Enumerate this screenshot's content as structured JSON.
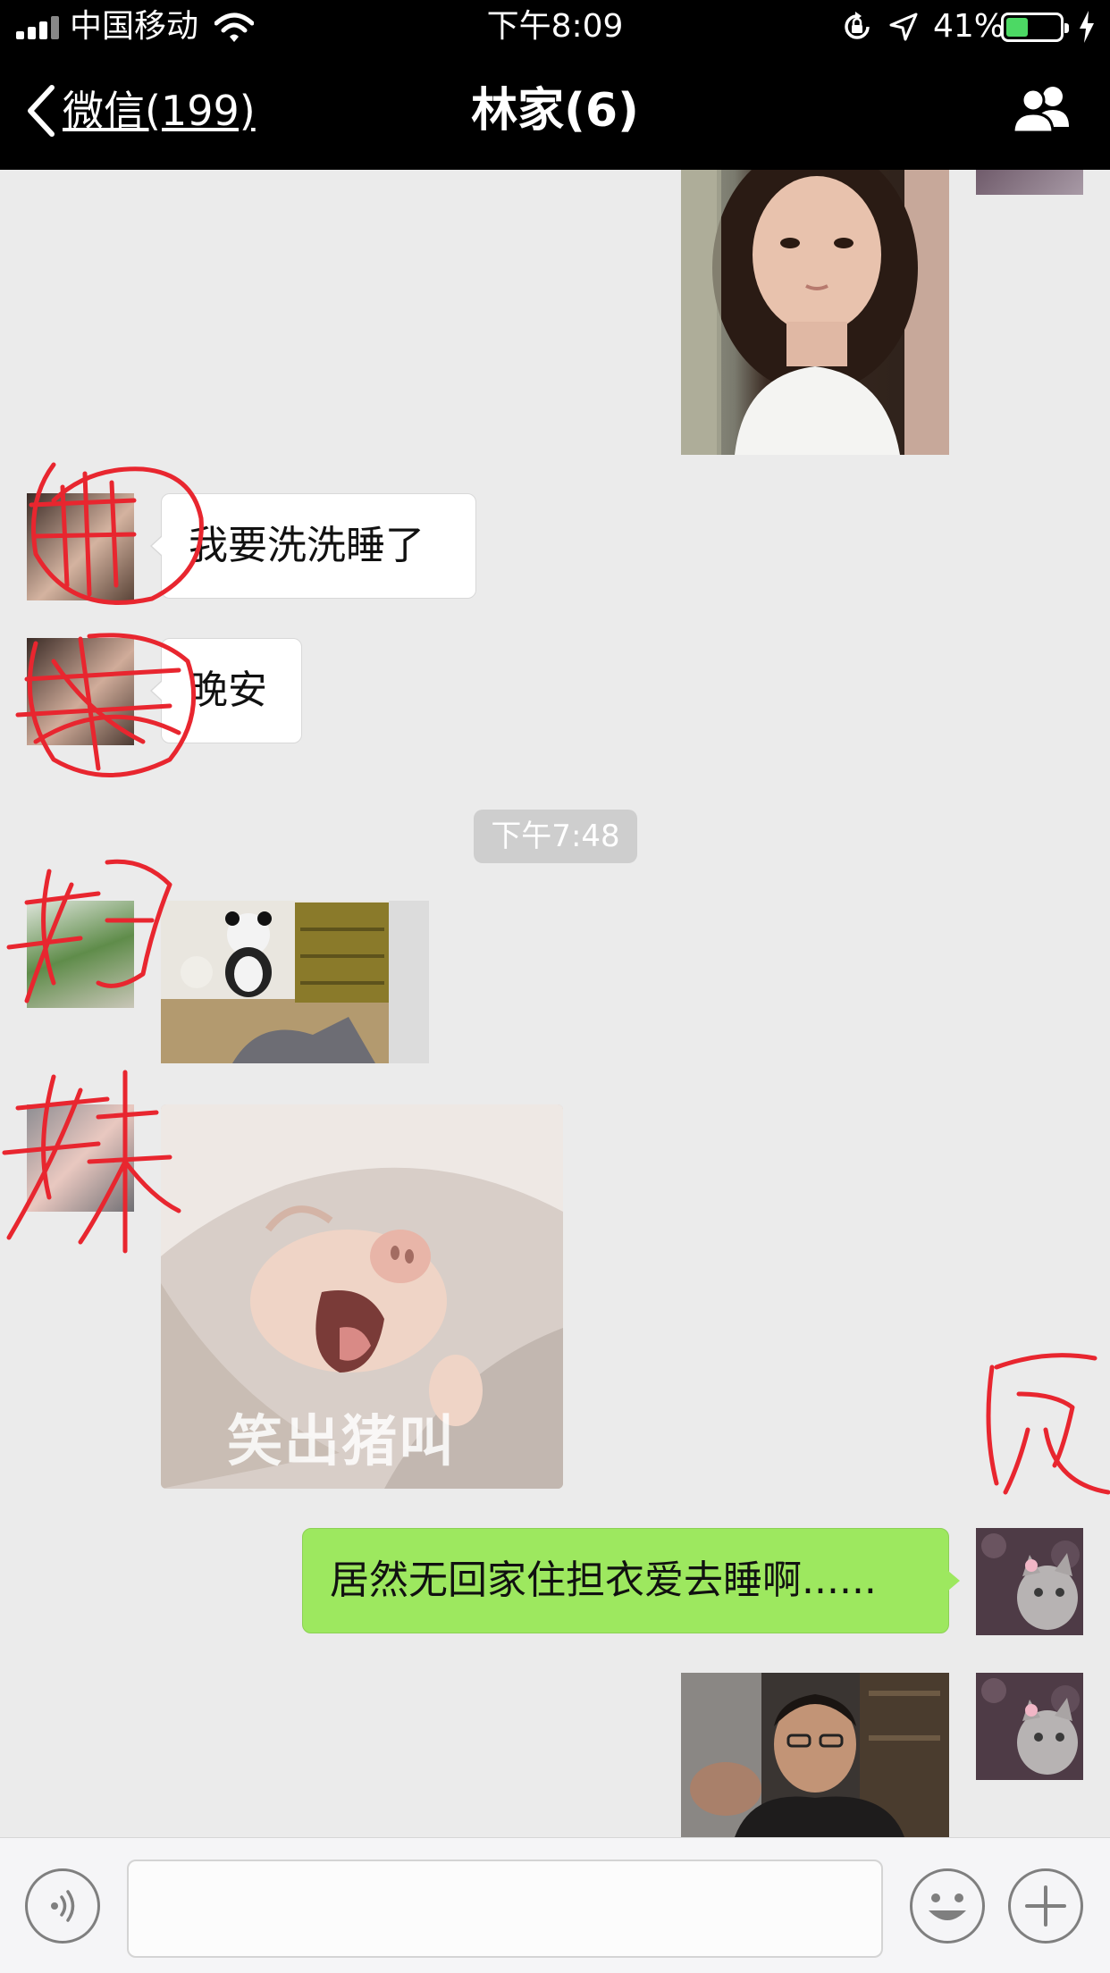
{
  "status_bar": {
    "carrier": "中国移动",
    "time": "下午8:09",
    "battery_percent": "41%",
    "battery_level": 0.41
  },
  "nav": {
    "back_label": "微信(199)",
    "title": "林家(6)"
  },
  "messages": {
    "text_1": "我要洗洗睡了",
    "text_2": "晚安",
    "timestamp": "下午7:48",
    "sticker_caption": "笑出猪叫",
    "text_mine": "居然无回家住担衣爱去睡啊......"
  },
  "colors": {
    "background": "#ebebeb",
    "bar": "#000000",
    "my_bubble": "#9de85f",
    "annotation": "#e8262f"
  },
  "icons": {
    "back": "chevron-left-icon",
    "group": "group-members-icon",
    "voice": "voice-icon",
    "emoji": "emoji-icon",
    "plus": "plus-icon"
  }
}
